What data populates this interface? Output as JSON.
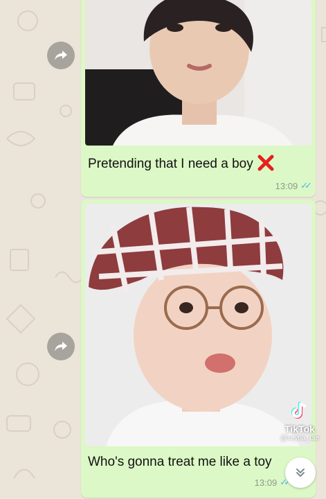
{
  "messages": [
    {
      "caption": "Pretending that I need a boy",
      "emoji": "cross-mark-emoji",
      "time": "13:09",
      "status": "read"
    },
    {
      "caption": "Who's gonna treat me like a toy",
      "time": "13:09",
      "status": "read"
    }
  ],
  "watermark": {
    "brand": "TikTok",
    "handle": "@seyna_tae"
  },
  "icons": {
    "forward": "forward-arrow-icon",
    "scroll": "chevron-double-down-icon",
    "tiktok": "tiktok-logo-icon"
  },
  "colors": {
    "bubble": "#dcf8c6",
    "wallpaper": "#ebe4d9",
    "read_ticks": "#4fb6ec",
    "cross": "#e5201e"
  }
}
